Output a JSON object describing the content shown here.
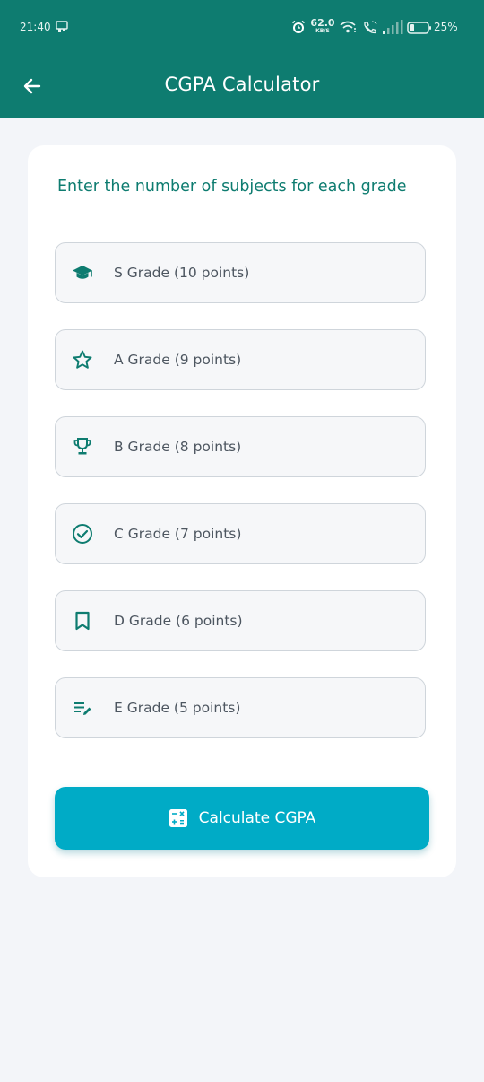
{
  "status_bar": {
    "time": "21:40",
    "net_speed_value": "62.0",
    "net_speed_unit": "KB/S",
    "battery": "25%"
  },
  "app_bar": {
    "title": "CGPA Calculator",
    "back_icon": "arrow-left-icon",
    "background": "#0e7c70"
  },
  "form": {
    "instruction": "Enter the number of subjects for each grade",
    "fields": [
      {
        "label": "S Grade (10 points)",
        "icon": "graduation-cap-icon",
        "value": ""
      },
      {
        "label": "A Grade (9 points)",
        "icon": "star-outline-icon",
        "value": ""
      },
      {
        "label": "B Grade (8 points)",
        "icon": "trophy-icon",
        "value": ""
      },
      {
        "label": "C Grade (7 points)",
        "icon": "check-circle-icon",
        "value": ""
      },
      {
        "label": "D Grade (6 points)",
        "icon": "bookmark-icon",
        "value": ""
      },
      {
        "label": "E Grade (5 points)",
        "icon": "edit-list-icon",
        "value": ""
      }
    ],
    "submit_label": "Calculate CGPA",
    "submit_icon": "calculator-icon",
    "accent": "#0e7c70",
    "button_color": "#00abc6"
  }
}
